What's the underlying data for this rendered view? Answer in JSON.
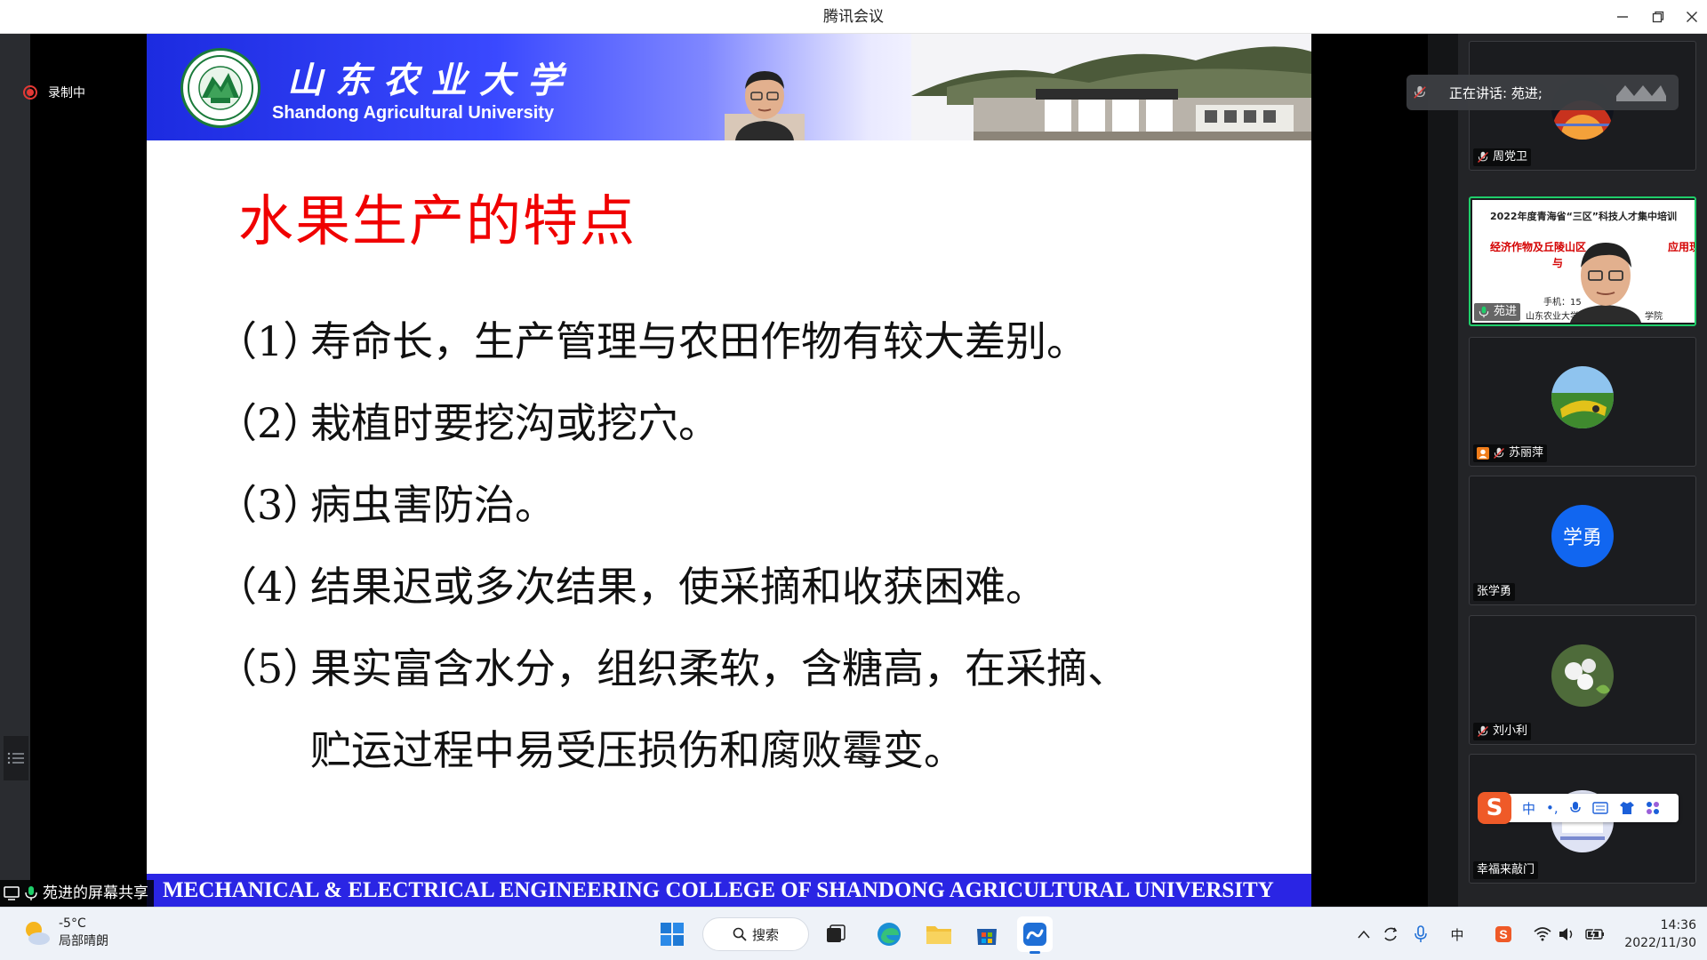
{
  "window": {
    "title": "腾讯会议"
  },
  "recording": {
    "label": "录制中"
  },
  "share": {
    "label": "苑进的屏幕共享"
  },
  "speaking": {
    "label": "正在讲话: 苑进;"
  },
  "slide": {
    "university_cn": "山东农业大学",
    "university_en": "Shandong Agricultural University",
    "title": "水果生产的特点",
    "items": [
      {
        "num": "（1）",
        "text": "寿命长，生产管理与农田作物有较大差别。"
      },
      {
        "num": "（2）",
        "text": "栽植时要挖沟或挖穴。"
      },
      {
        "num": "（3）",
        "text": "病虫害防治。"
      },
      {
        "num": "（4）",
        "text": "结果迟或多次结果，使采摘和收获困难。"
      },
      {
        "num": "（5）",
        "text": "果实富含水分，组织柔软，含糖高，在采摘、"
      }
    ],
    "continuation": "贮运过程中易受压损伤和腐败霉变。",
    "footer": "MECHANICAL & ELECTRICAL ENGINEERING COLLEGE OF SHANDONG AGRICULTURAL UNIVERSITY"
  },
  "participants": [
    {
      "name": "周党卫",
      "muted": true
    },
    {
      "name": "苑进",
      "muted": false,
      "speaking": true,
      "mini_slide": {
        "line1": "2022年度青海省“三区”科技人才集中培训",
        "line2": "经济作物及丘陵山区",
        "line2b": "应用现状",
        "line3": "与",
        "line4": "手机：15",
        "line5": "山东农业大学机",
        "line5b": "学院"
      }
    },
    {
      "name": "苏丽萍",
      "muted": true
    },
    {
      "name": "张学勇",
      "muted": false,
      "avatar_text": "学勇"
    },
    {
      "name": "刘小利",
      "muted": true
    },
    {
      "name": "幸福来敲门",
      "muted": false
    }
  ],
  "ime": {
    "items": [
      "中",
      "•,",
      "mic",
      "keyboard",
      "shirt",
      "apps"
    ]
  },
  "taskbar": {
    "weather_temp": "-5°C",
    "weather_cond": "局部晴朗",
    "search_label": "搜索",
    "ime_mode": "中",
    "time": "14:36",
    "date": "2022/11/30"
  }
}
